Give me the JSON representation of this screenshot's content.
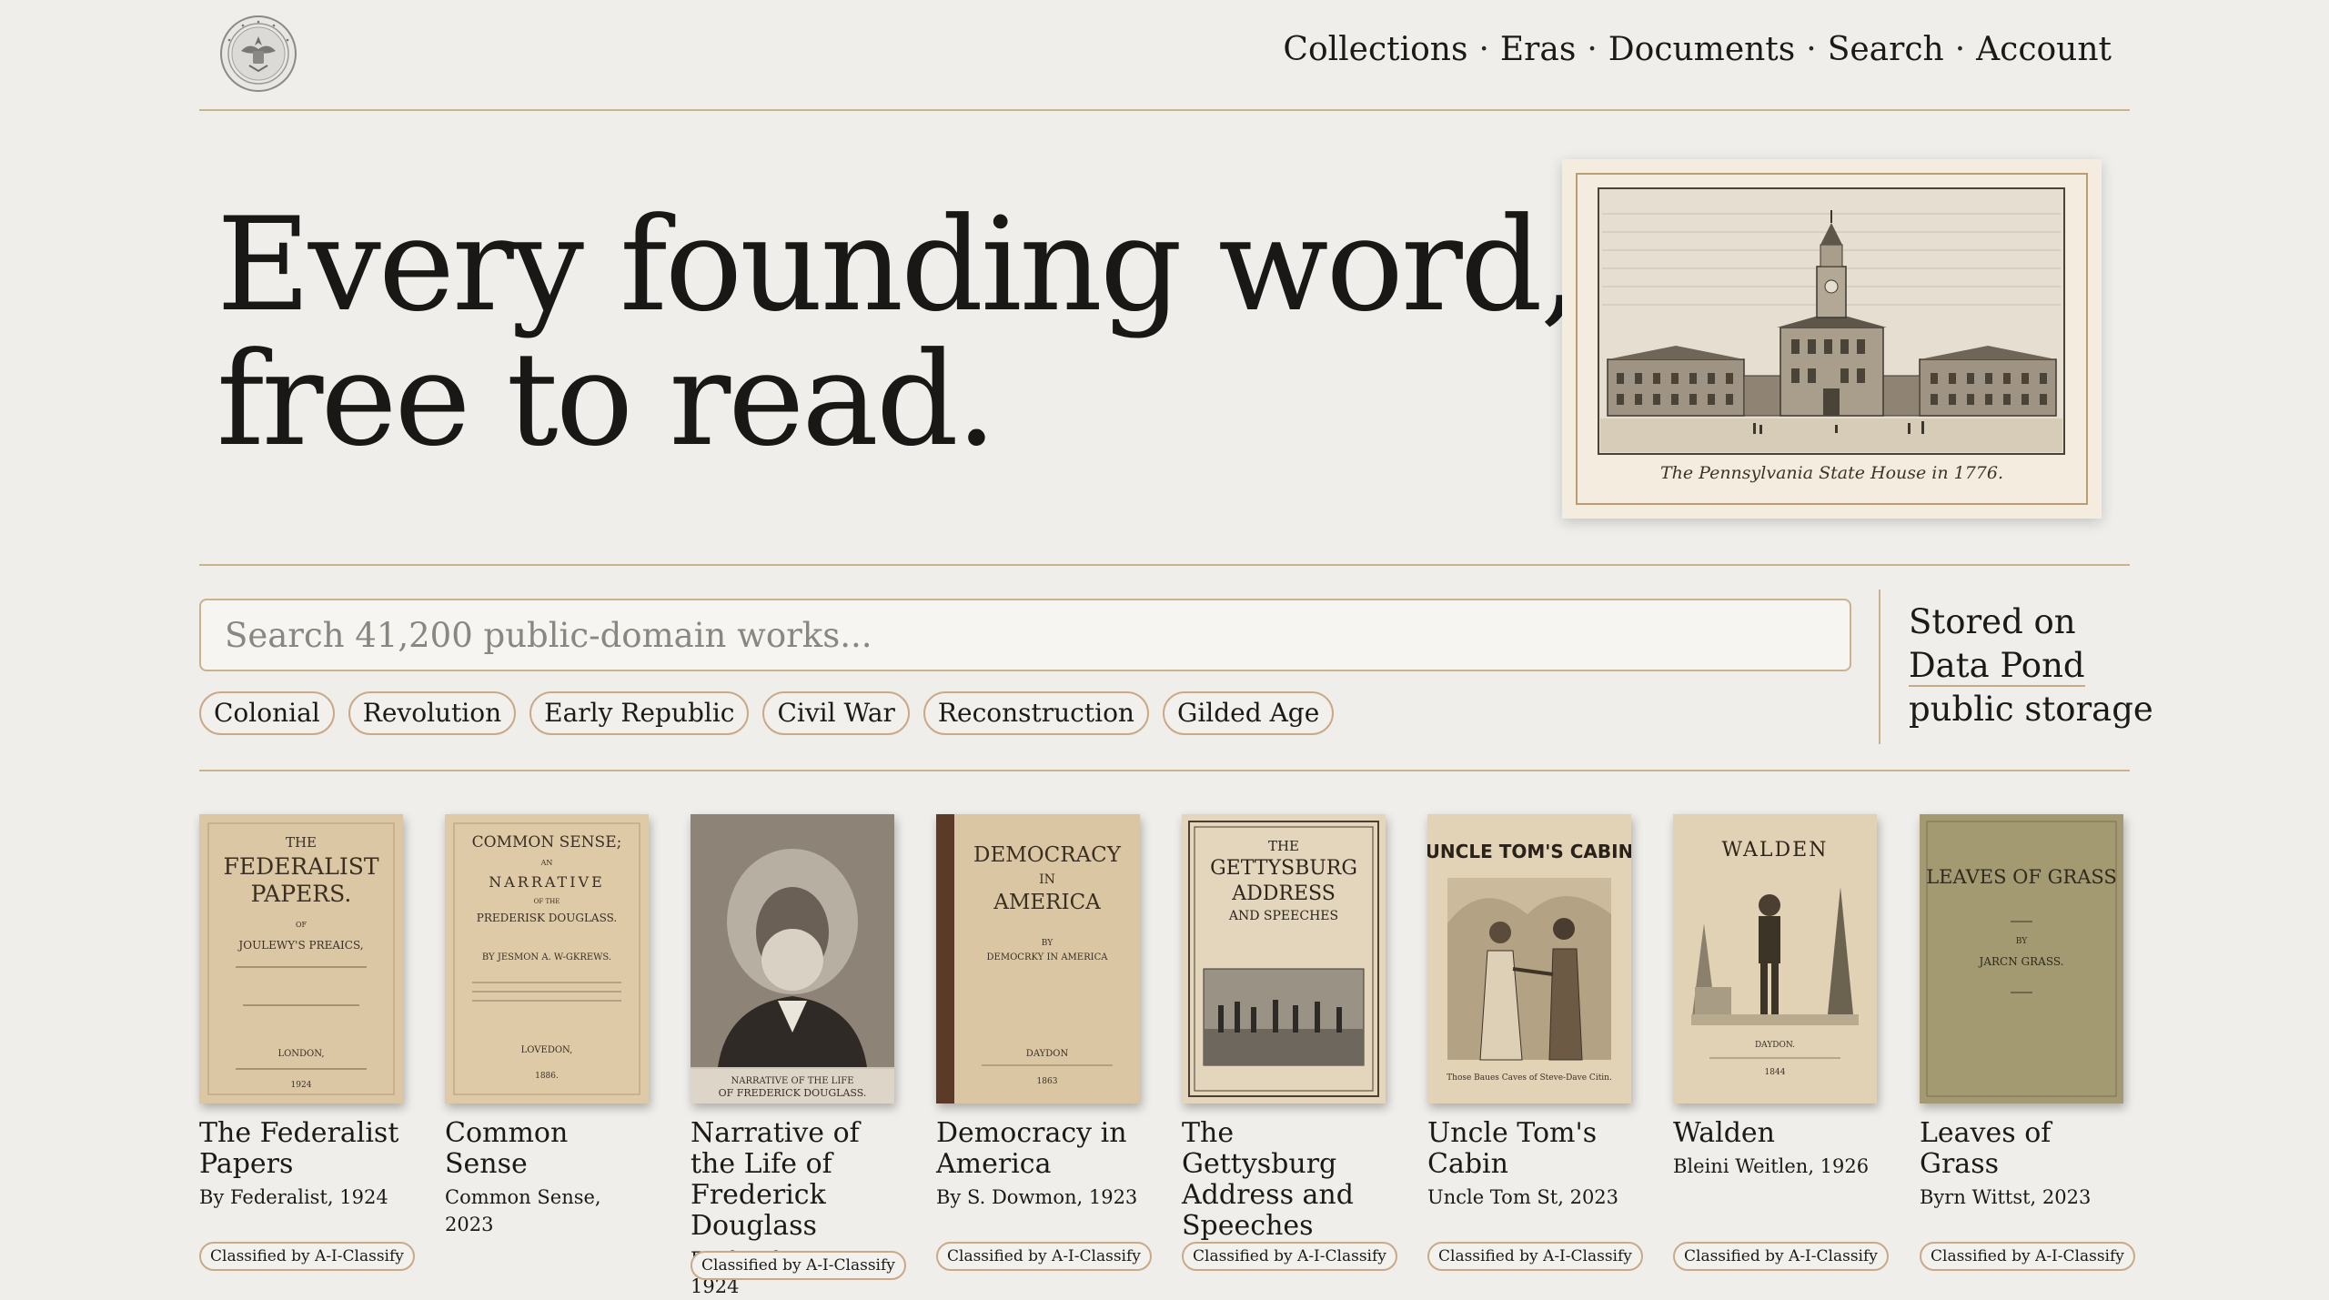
{
  "nav": {
    "items": [
      "Collections",
      "Eras",
      "Documents",
      "Search",
      "Account"
    ],
    "separator": "·"
  },
  "hero": {
    "title_line1": "Every founding word,",
    "title_line2": "free to read.",
    "image_caption": "The Pennsylvania State House in 1776."
  },
  "search": {
    "placeholder": "Search 41,200 public-domain works...",
    "value": ""
  },
  "eras": [
    "Colonial",
    "Revolution",
    "Early Republic",
    "Civil War",
    "Reconstruction",
    "Gilded Age"
  ],
  "storage": {
    "line1": "Stored on",
    "line2": "Data Pond",
    "line3": "public storage"
  },
  "books": [
    {
      "title": "The Federalist Papers",
      "byline": "By Federalist, 1924",
      "badge": "Classified by A-I-Classify",
      "cover": {
        "line1": "THE",
        "line2": "FEDERALIST",
        "line3": "PAPERS.",
        "line4": "OF",
        "line5": "JOULEWY'S PREAICS,",
        "line6": "LONDON,",
        "line7": "1924"
      }
    },
    {
      "title": "Common Sense",
      "byline": "Common Sense, 2023",
      "badge": "Classified by A-I-Classify",
      "cover": {
        "line1": "COMMON SENSE;",
        "line2": "AN",
        "line3": "NARRATIVE",
        "line4": "OF THE",
        "line5": "PREDERISK DOUGLASS.",
        "line6": "BY JESMON A. W-GKREWS.",
        "line7": "LOVEDON,",
        "line8": "1886."
      }
    },
    {
      "title": "Narrative of the Life of Frederick Douglass",
      "byline": "Frederick Dous, 1924",
      "badge": "Classified by A-I-Classify",
      "cover": {
        "line1": "NARRATIVE OF THE LIFE",
        "line2": "OF FREDERICK DOUGLASS."
      }
    },
    {
      "title": "Democracy in America",
      "byline": "By S. Dowmon, 1923",
      "badge": "Classified by A-I-Classify",
      "cover": {
        "line1": "DEMOCRACY",
        "line2": "IN",
        "line3": "AMERICA",
        "line4": "BY",
        "line5": "DEMOCRKY IN AMERICA",
        "line6": "DAYDON",
        "line7": "1863"
      }
    },
    {
      "title": "The Gettysburg Address and Speeches",
      "byline": "",
      "badge": "Classified by A-I-Classify",
      "cover": {
        "line1": "THE",
        "line2": "GETTYSBURG",
        "line3": "ADDRESS",
        "line4": "AND SPEECHES"
      }
    },
    {
      "title": "Uncle Tom's Cabin",
      "byline": "Uncle Tom St, 2023",
      "badge": "Classified by A-I-Classify",
      "cover": {
        "line1": "UNCLE TOM'S CABIN",
        "line2": "Those Baues Caves of Steve-Dave Citin."
      }
    },
    {
      "title": "Walden",
      "byline": "Bleini Weitlen, 1926",
      "badge": "Classified by A-I-Classify",
      "cover": {
        "line1": "WALDEN",
        "line2": "DAYDON.",
        "line3": "1844"
      }
    },
    {
      "title": "Leaves of Grass",
      "byline": "Byrn Wittst, 2023",
      "badge": "Classified by A-I-Classify",
      "cover": {
        "line1": "LEAVES OF GRASS",
        "line2": "BY",
        "line3": "JARCN GRASS."
      }
    }
  ]
}
